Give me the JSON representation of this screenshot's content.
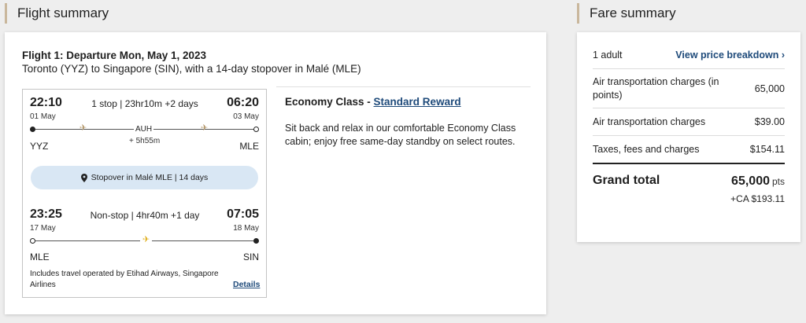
{
  "headings": {
    "flight_summary": "Flight summary",
    "fare_summary": "Fare summary"
  },
  "flight": {
    "title": "Flight 1: Departure Mon, May 1, 2023",
    "route": "Toronto (YYZ) to Singapore (SIN), with a 14-day stopover in Malé (MLE)",
    "leg1": {
      "depart_time": "22:10",
      "depart_date": "01 May",
      "summary": "1 stop | 23hr10m +2 days",
      "arrive_time": "06:20",
      "arrive_date": "03 May",
      "stop_code": "AUH",
      "layover": "+ 5h55m",
      "from": "YYZ",
      "to": "MLE"
    },
    "stopover": {
      "icon": "map-pin-icon",
      "label": "Stopover in Malé MLE | 14 days"
    },
    "leg2": {
      "depart_time": "23:25",
      "depart_date": "17 May",
      "summary": "Non-stop | 4hr40m +1 day",
      "arrive_time": "07:05",
      "arrive_date": "18 May",
      "from": "MLE",
      "to": "SIN"
    },
    "operated_by": "Includes travel operated by Etihad Airways, Singapore Airlines",
    "details_link": "Details",
    "cabin_prefix": "Economy Class - ",
    "cabin_link": "Standard Reward",
    "cabin_description": "Sit back and relax in our comfortable Economy Class cabin; enjoy free same-day standby on select routes."
  },
  "fare": {
    "passengers": "1 adult",
    "breakdown_link": "View price breakdown ›",
    "rows": [
      {
        "label": "Air transportation charges (in points)",
        "value": "65,000"
      },
      {
        "label": "Air transportation charges",
        "value": "$39.00"
      },
      {
        "label": "Taxes, fees and charges",
        "value": "$154.11"
      }
    ],
    "grand_total_label": "Grand total",
    "grand_total_points": "65,000",
    "grand_total_unit": "pts",
    "grand_total_cash": "+CA $193.11"
  },
  "colors": {
    "accent_border": "#c9b79c",
    "link": "#1e4a7a",
    "stopover_bg": "#d9e7f4",
    "plane_icon": "#b69a6e"
  }
}
